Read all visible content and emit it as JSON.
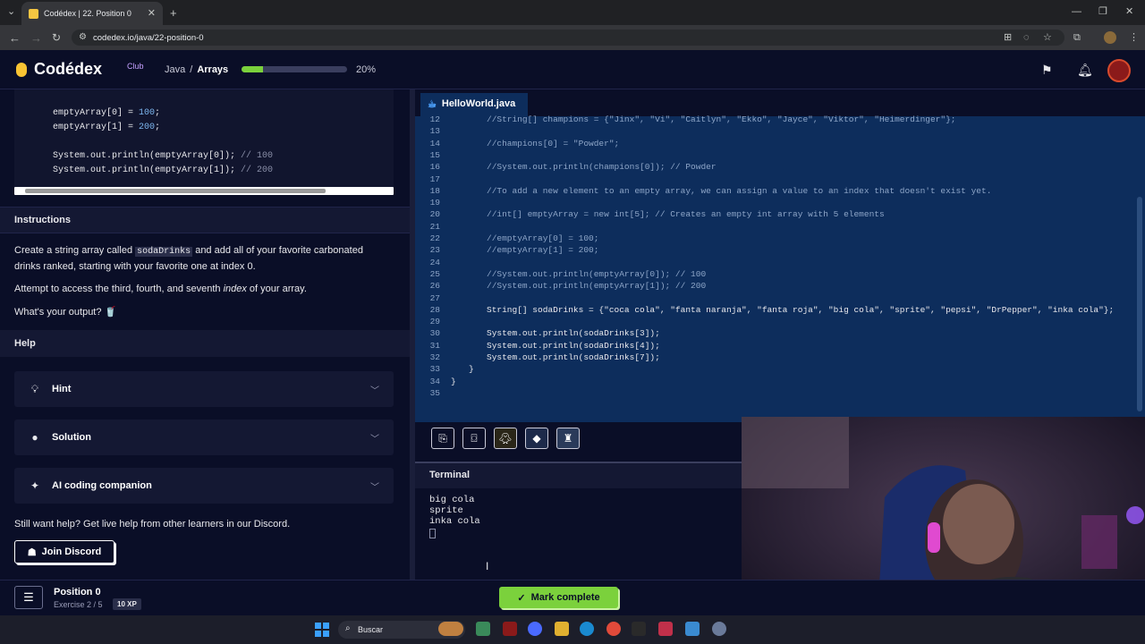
{
  "browser": {
    "tab_title": "Codédex | 22. Position 0",
    "url": "codedex.io/java/22-position-0"
  },
  "header": {
    "logo_text": "Codédex",
    "logo_badge": "Club",
    "course": "Java",
    "separator": "/",
    "chapter": "Arrays",
    "progress_fraction": 0.2,
    "progress_label": "20%"
  },
  "left": {
    "code_lines": [
      {
        "text": "emptyArray[0] = ",
        "num": "100",
        "tail": ";"
      },
      {
        "text": "emptyArray[1] = ",
        "num": "200",
        "tail": ";"
      },
      {
        "text": "System.out.println(emptyArray[0]); ",
        "comment": "// 100"
      },
      {
        "text": "System.out.println(emptyArray[1]); ",
        "comment": "// 200"
      }
    ],
    "instructions_title": "Instructions",
    "instr_p1_a": "Create a string array called ",
    "instr_p1_code": "sodaDrinks",
    "instr_p1_b": " and add all of your favorite carbonated",
    "instr_p1_c": "drinks ranked, starting with your favorite one at index 0.",
    "instr_p2_a": "Attempt to access the third, fourth, and seventh ",
    "instr_p2_em": "index",
    "instr_p2_b": " of your array.",
    "instr_p3": "What's your output? 🥤",
    "help_title": "Help",
    "hint": "Hint",
    "solution": "Solution",
    "ai": "AI coding companion",
    "discord_text": "Still want help? Get live help from other learners in our Discord.",
    "join_discord": "Join Discord"
  },
  "editor": {
    "file_name": "HelloWorld.java",
    "lines": [
      {
        "n": "12",
        "indent": 2,
        "t": "//String[] champions = {\"Jinx\", \"Vi\", \"Caitlyn\", \"Ekko\", \"Jayce\", \"Viktor\", \"Heimerdinger\"};",
        "cm": true
      },
      {
        "n": "13",
        "indent": 0,
        "t": ""
      },
      {
        "n": "14",
        "indent": 2,
        "t": "//champions[0] = \"Powder\";",
        "cm": true
      },
      {
        "n": "15",
        "indent": 0,
        "t": ""
      },
      {
        "n": "16",
        "indent": 2,
        "t": "//System.out.println(champions[0]); // Powder",
        "cm": true
      },
      {
        "n": "17",
        "indent": 0,
        "t": ""
      },
      {
        "n": "18",
        "indent": 2,
        "t": "//To add a new element to an empty array, we can assign a value to an index that doesn't exist yet.",
        "cm": true
      },
      {
        "n": "19",
        "indent": 0,
        "t": ""
      },
      {
        "n": "20",
        "indent": 2,
        "t": "//int[] emptyArray = new int[5]; // Creates an empty int array with 5 elements",
        "cm": true
      },
      {
        "n": "21",
        "indent": 0,
        "t": ""
      },
      {
        "n": "22",
        "indent": 2,
        "t": "//emptyArray[0] = 100;",
        "cm": true
      },
      {
        "n": "23",
        "indent": 2,
        "t": "//emptyArray[1] = 200;",
        "cm": true
      },
      {
        "n": "24",
        "indent": 0,
        "t": ""
      },
      {
        "n": "25",
        "indent": 2,
        "t": "//System.out.println(emptyArray[0]); // 100",
        "cm": true
      },
      {
        "n": "26",
        "indent": 2,
        "t": "//System.out.println(emptyArray[1]); // 200",
        "cm": true
      },
      {
        "n": "27",
        "indent": 0,
        "t": ""
      },
      {
        "n": "28",
        "indent": 2,
        "t": "String[] sodaDrinks = {\"coca cola\", \"fanta naranja\", \"fanta roja\", \"big cola\", \"sprite\", \"pepsi\", \"DrPepper\", \"inka cola\"};",
        "cm": false
      },
      {
        "n": "29",
        "indent": 0,
        "t": ""
      },
      {
        "n": "30",
        "indent": 2,
        "t": "System.out.println(sodaDrinks[3]);",
        "cm": false
      },
      {
        "n": "31",
        "indent": 2,
        "t": "System.out.println(sodaDrinks[4]);",
        "cm": false
      },
      {
        "n": "32",
        "indent": 2,
        "t": "System.out.println(sodaDrinks[7]);",
        "cm": false
      },
      {
        "n": "33",
        "indent": 1,
        "t": "}",
        "cm": false
      },
      {
        "n": "34",
        "indent": 0,
        "t": "}",
        "cm": false
      },
      {
        "n": "35",
        "indent": 0,
        "t": ""
      }
    ]
  },
  "terminal": {
    "title": "Terminal",
    "output": [
      "big cola",
      "sprite",
      "inka cola"
    ]
  },
  "bottom": {
    "exercise_title": "Position 0",
    "exercise_sub": "Exercise 2 / 5",
    "xp": "10 XP",
    "mark_complete": "Mark complete"
  },
  "taskbar": {
    "search_placeholder": "Buscar"
  },
  "colors": {
    "accent_green": "#7bd13c",
    "editor_bg": "#0d2d5c",
    "page_bg": "#0a0e27"
  }
}
